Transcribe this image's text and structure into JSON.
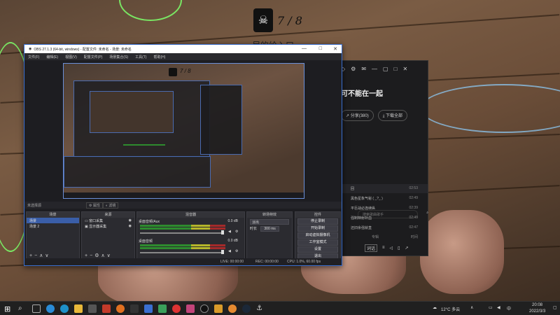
{
  "overlay": {
    "counter": "7 / 8",
    "subtitle": "尽的给入口"
  },
  "player": {
    "title": "可不能在一起",
    "share_label": "分享(380)",
    "download_label": "下载全部",
    "search_placeholder": "搜索歌曲歌手",
    "col_album": "专辑",
    "col_time": "时间",
    "rows": [
      {
        "name": "回",
        "time": "02:53"
      },
      {
        "name": "黑色星象气秘 ( _?_ )",
        "time": "02:49"
      },
      {
        "name": "平巨战必连续纵",
        "time": "02:39"
      },
      {
        "name": "强制映射补血",
        "time": "02:49"
      },
      {
        "name": "还旧余强就直",
        "time": "02:47"
      }
    ],
    "bottom_label": "词话"
  },
  "obs": {
    "window_title": "OBS 27.1.3 (64-bit, windows) - 配置文件: 未命名 - 场景: 未命名",
    "menu": [
      "文件(F)",
      "编辑(E)",
      "视图(V)",
      "配置文件(P)",
      "场景集合(S)",
      "工具(T)",
      "帮助(H)"
    ],
    "selected_source": "未选择源",
    "props_label": "属性",
    "filters_label": "滤镜",
    "docks": {
      "scenes_title": "场景",
      "scenes": [
        "场景",
        "场景 2"
      ],
      "sources_title": "来源",
      "sources": [
        "窗口采集",
        "显示器采集"
      ],
      "mixer_title": "混音器",
      "mixer": [
        {
          "name": "桌面音频/Aux",
          "db": "0.0 dB"
        },
        {
          "name": "桌面音频",
          "db": "0.0 dB"
        }
      ],
      "transitions_title": "转场特效",
      "transition_value": "淡出",
      "duration_label": "时长",
      "duration_value": "300 ms",
      "controls_title": "控件",
      "controls": [
        "停止录制",
        "开始录制",
        "启动虚拟摄像机",
        "工作室模式",
        "设置",
        "退出"
      ]
    },
    "status": {
      "live": "LIVE: 00:00:00",
      "rec": "REC: 00:00:00",
      "cpu": "CPU: 1.0%, 60.00 fps"
    }
  },
  "tray": {
    "weather": "12°C 多云",
    "time": "20:08",
    "date": "2022/3/3"
  },
  "colors": {
    "accent": "#3a6fd0",
    "meter_green": "#2e8b2e",
    "wire_green": "#7dff6a"
  }
}
